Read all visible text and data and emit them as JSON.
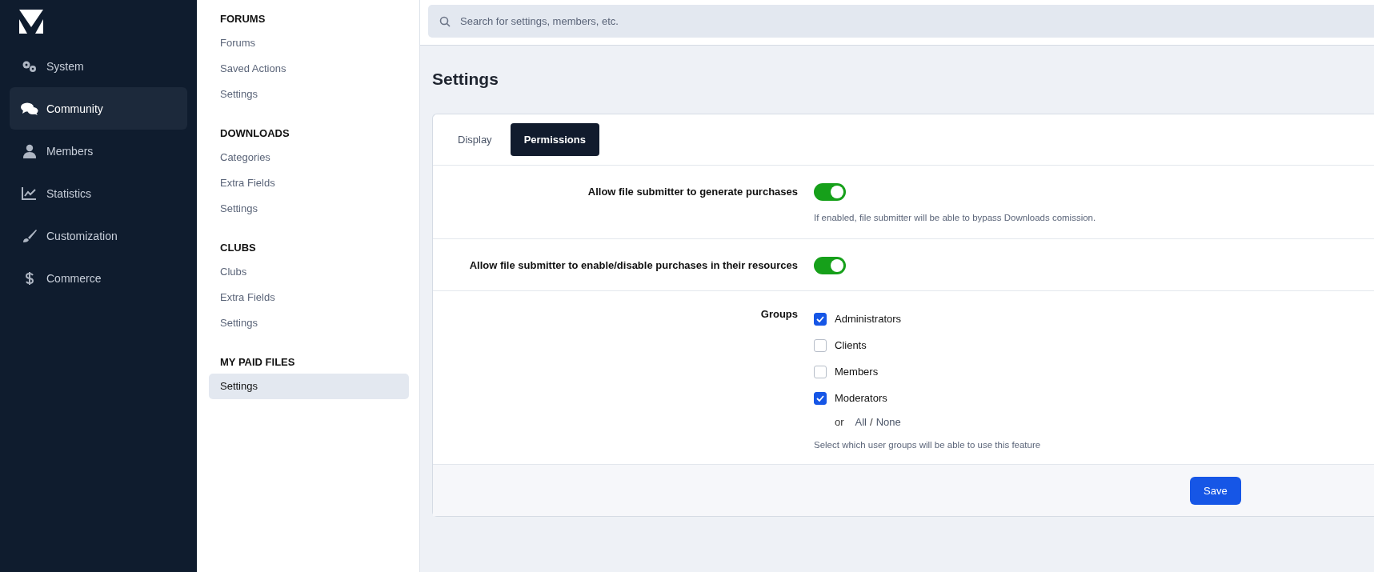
{
  "sidebar": {
    "items": [
      {
        "label": "System",
        "kind": "gears",
        "selected": false
      },
      {
        "label": "Community",
        "kind": "chat",
        "selected": true
      },
      {
        "label": "Members",
        "kind": "person",
        "selected": false
      },
      {
        "label": "Statistics",
        "kind": "chart",
        "selected": false
      },
      {
        "label": "Customization",
        "kind": "brush",
        "selected": false
      },
      {
        "label": "Commerce",
        "kind": "dollar",
        "selected": false
      }
    ]
  },
  "subnav": {
    "sections": [
      {
        "title": "FORUMS",
        "items": [
          {
            "label": "Forums",
            "selected": false
          },
          {
            "label": "Saved Actions",
            "selected": false
          },
          {
            "label": "Settings",
            "selected": false
          }
        ]
      },
      {
        "title": "DOWNLOADS",
        "items": [
          {
            "label": "Categories",
            "selected": false
          },
          {
            "label": "Extra Fields",
            "selected": false
          },
          {
            "label": "Settings",
            "selected": false
          }
        ]
      },
      {
        "title": "CLUBS",
        "items": [
          {
            "label": "Clubs",
            "selected": false
          },
          {
            "label": "Extra Fields",
            "selected": false
          },
          {
            "label": "Settings",
            "selected": false
          }
        ]
      },
      {
        "title": "MY PAID FILES",
        "items": [
          {
            "label": "Settings",
            "selected": true
          }
        ]
      }
    ]
  },
  "search": {
    "placeholder": "Search for settings, members, etc."
  },
  "page_title": "Settings",
  "tabs": [
    {
      "label": "Display",
      "selected": false
    },
    {
      "label": "Permissions",
      "selected": true
    }
  ],
  "fields": [
    {
      "kind": "toggle",
      "label": "Allow file submitter to generate purchases",
      "on": true,
      "description": "If enabled, file submitter will be able to bypass Downloads comission."
    },
    {
      "kind": "toggle",
      "label": "Allow file submitter to enable/disable purchases in their resources",
      "on": true
    },
    {
      "kind": "checkboxes",
      "label": "Groups",
      "options": [
        {
          "label": "Administrators",
          "checked": true
        },
        {
          "label": "Clients",
          "checked": false
        },
        {
          "label": "Members",
          "checked": false
        },
        {
          "label": "Moderators",
          "checked": true
        }
      ],
      "select_text": "or",
      "all_link": "All",
      "separator": "/",
      "none_link": "None",
      "description": "Select which user groups will be able to use this feature"
    }
  ],
  "save_button": "Save"
}
